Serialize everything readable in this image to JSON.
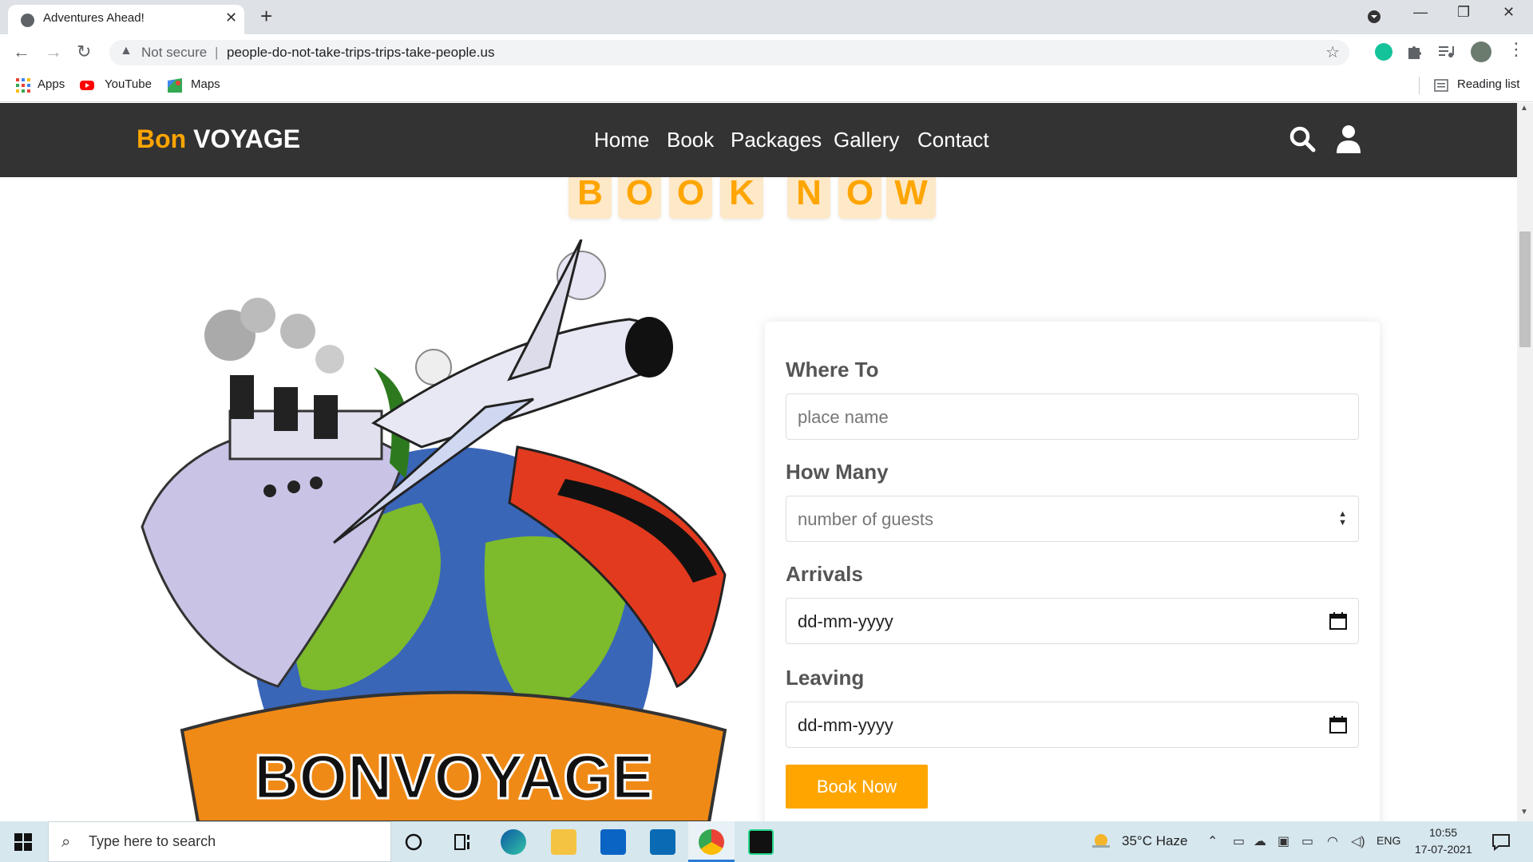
{
  "browser": {
    "tab_title": "Adventures Ahead!",
    "tab_close": "✕",
    "new_tab": "+",
    "window_controls": {
      "minimize": "—",
      "restore": "❐",
      "close": "✕"
    },
    "security_label": "Not secure",
    "separator": "|",
    "url": "people-do-not-take-trips-trips-take-people.us",
    "bookmarks": [
      {
        "label": "Apps",
        "icon": "apps-grid-icon"
      },
      {
        "label": "YouTube",
        "icon": "youtube-icon"
      },
      {
        "label": "Maps",
        "icon": "maps-icon"
      }
    ],
    "reading_list": "Reading list"
  },
  "site": {
    "logo_bon": "Bon",
    "logo_voyage": "VOYAGE",
    "nav": [
      "Home",
      "Book",
      "Packages",
      "Gallery",
      "Contact"
    ],
    "brand_color": "#ffa500",
    "header_bg": "#333333"
  },
  "heading": {
    "letters": [
      "B",
      "O",
      "O",
      "K",
      "N",
      "O",
      "W"
    ]
  },
  "illustration": {
    "banner_text": "BONVOYAGE"
  },
  "form": {
    "where_label": "Where To",
    "where_placeholder": "place name",
    "howmany_label": "How Many",
    "howmany_placeholder": "number of guests",
    "arrivals_label": "Arrivals",
    "arrivals_value": "dd-mm-yyyy",
    "leaving_label": "Leaving",
    "leaving_value": "dd-mm-yyyy",
    "submit_label": "Book Now"
  },
  "taskbar": {
    "search_placeholder": "Type here to search",
    "weather": "35°C  Haze",
    "language": "ENG",
    "time": "10:55",
    "date": "17-07-2021"
  }
}
